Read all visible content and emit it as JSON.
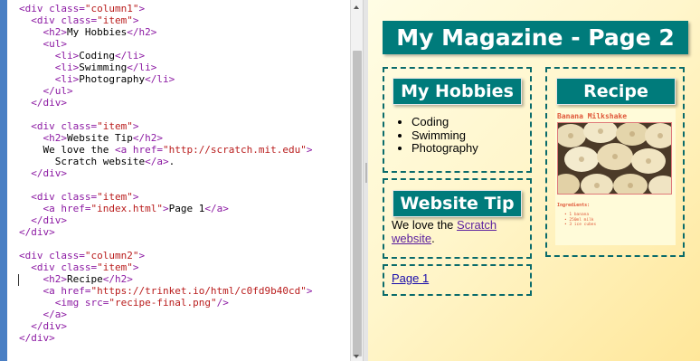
{
  "editor": {
    "lines": [
      [
        [
          "tag",
          "<div class="
        ],
        [
          "str",
          "\"column1\""
        ],
        [
          "tag",
          ">"
        ]
      ],
      [
        [
          "txt",
          "  "
        ],
        [
          "tag",
          "<div class="
        ],
        [
          "str",
          "\"item\""
        ],
        [
          "tag",
          ">"
        ]
      ],
      [
        [
          "txt",
          "    "
        ],
        [
          "tag",
          "<h2>"
        ],
        [
          "txt",
          "My Hobbies"
        ],
        [
          "tag",
          "</h2>"
        ]
      ],
      [
        [
          "txt",
          "    "
        ],
        [
          "tag",
          "<ul>"
        ]
      ],
      [
        [
          "txt",
          "      "
        ],
        [
          "tag",
          "<li>"
        ],
        [
          "txt",
          "Coding"
        ],
        [
          "tag",
          "</li>"
        ]
      ],
      [
        [
          "txt",
          "      "
        ],
        [
          "tag",
          "<li>"
        ],
        [
          "txt",
          "Swimming"
        ],
        [
          "tag",
          "</li>"
        ]
      ],
      [
        [
          "txt",
          "      "
        ],
        [
          "tag",
          "<li>"
        ],
        [
          "txt",
          "Photography"
        ],
        [
          "tag",
          "</li>"
        ]
      ],
      [
        [
          "txt",
          "    "
        ],
        [
          "tag",
          "</ul>"
        ]
      ],
      [
        [
          "txt",
          "  "
        ],
        [
          "tag",
          "</div>"
        ]
      ],
      [],
      [
        [
          "txt",
          "  "
        ],
        [
          "tag",
          "<div class="
        ],
        [
          "str",
          "\"item\""
        ],
        [
          "tag",
          ">"
        ]
      ],
      [
        [
          "txt",
          "    "
        ],
        [
          "tag",
          "<h2>"
        ],
        [
          "txt",
          "Website Tip"
        ],
        [
          "tag",
          "</h2>"
        ]
      ],
      [
        [
          "txt",
          "    We love the "
        ],
        [
          "tag",
          "<a href="
        ],
        [
          "str",
          "\"http://scratch.mit.edu\""
        ],
        [
          "tag",
          ">"
        ]
      ],
      [
        [
          "txt",
          "      Scratch website"
        ],
        [
          "tag",
          "</a>"
        ],
        [
          "txt",
          "."
        ]
      ],
      [
        [
          "txt",
          "  "
        ],
        [
          "tag",
          "</div>"
        ]
      ],
      [],
      [
        [
          "txt",
          "  "
        ],
        [
          "tag",
          "<div class="
        ],
        [
          "str",
          "\"item\""
        ],
        [
          "tag",
          ">"
        ]
      ],
      [
        [
          "txt",
          "    "
        ],
        [
          "tag",
          "<a href="
        ],
        [
          "str",
          "\"index.html\""
        ],
        [
          "tag",
          ">"
        ],
        [
          "txt",
          "Page 1"
        ],
        [
          "tag",
          "</a>"
        ]
      ],
      [
        [
          "txt",
          "  "
        ],
        [
          "tag",
          "</div>"
        ]
      ],
      [
        [
          "tag",
          "</div>"
        ]
      ],
      [],
      [
        [
          "tag",
          "<div class="
        ],
        [
          "str",
          "\"column2\""
        ],
        [
          "tag",
          ">"
        ]
      ],
      [
        [
          "txt",
          "  "
        ],
        [
          "tag",
          "<div class="
        ],
        [
          "str",
          "\"item\""
        ],
        [
          "tag",
          ">"
        ]
      ],
      [
        [
          "txt",
          "    "
        ],
        [
          "tag",
          "<h2>"
        ],
        [
          "txt",
          "Recipe"
        ],
        [
          "tag",
          "</h2>"
        ]
      ],
      [
        [
          "txt",
          "    "
        ],
        [
          "tag",
          "<a href="
        ],
        [
          "str",
          "\"https://trinket.io/html/c0fd9b40cd\""
        ],
        [
          "tag",
          ">"
        ]
      ],
      [
        [
          "txt",
          "      "
        ],
        [
          "tag",
          "<img src="
        ],
        [
          "str",
          "\"recipe-final.png\""
        ],
        [
          "tag",
          "/>"
        ]
      ],
      [
        [
          "txt",
          "    "
        ],
        [
          "tag",
          "</a>"
        ]
      ],
      [
        [
          "txt",
          "  "
        ],
        [
          "tag",
          "</div>"
        ]
      ],
      [
        [
          "tag",
          "</div>"
        ]
      ]
    ]
  },
  "preview": {
    "title": "My Magazine - Page 2",
    "hobbies": {
      "heading": "My Hobbies",
      "items": [
        "Coding",
        "Swimming",
        "Photography"
      ]
    },
    "tip": {
      "heading": "Website Tip",
      "prefix": "We love the ",
      "link": "Scratch website",
      "suffix": "."
    },
    "nav": {
      "link": "Page 1"
    },
    "recipe": {
      "heading": "Recipe",
      "title": "Banana Milkshake",
      "ingredients_title": "Ingredients:",
      "ingredients": [
        "1 banana",
        "250ml milk",
        "3 ice cubes"
      ]
    }
  },
  "colors": {
    "accent": "#007b7b",
    "tag": "#8c1aa3",
    "string": "#b91c1c",
    "recipe_text": "#e0583a"
  }
}
